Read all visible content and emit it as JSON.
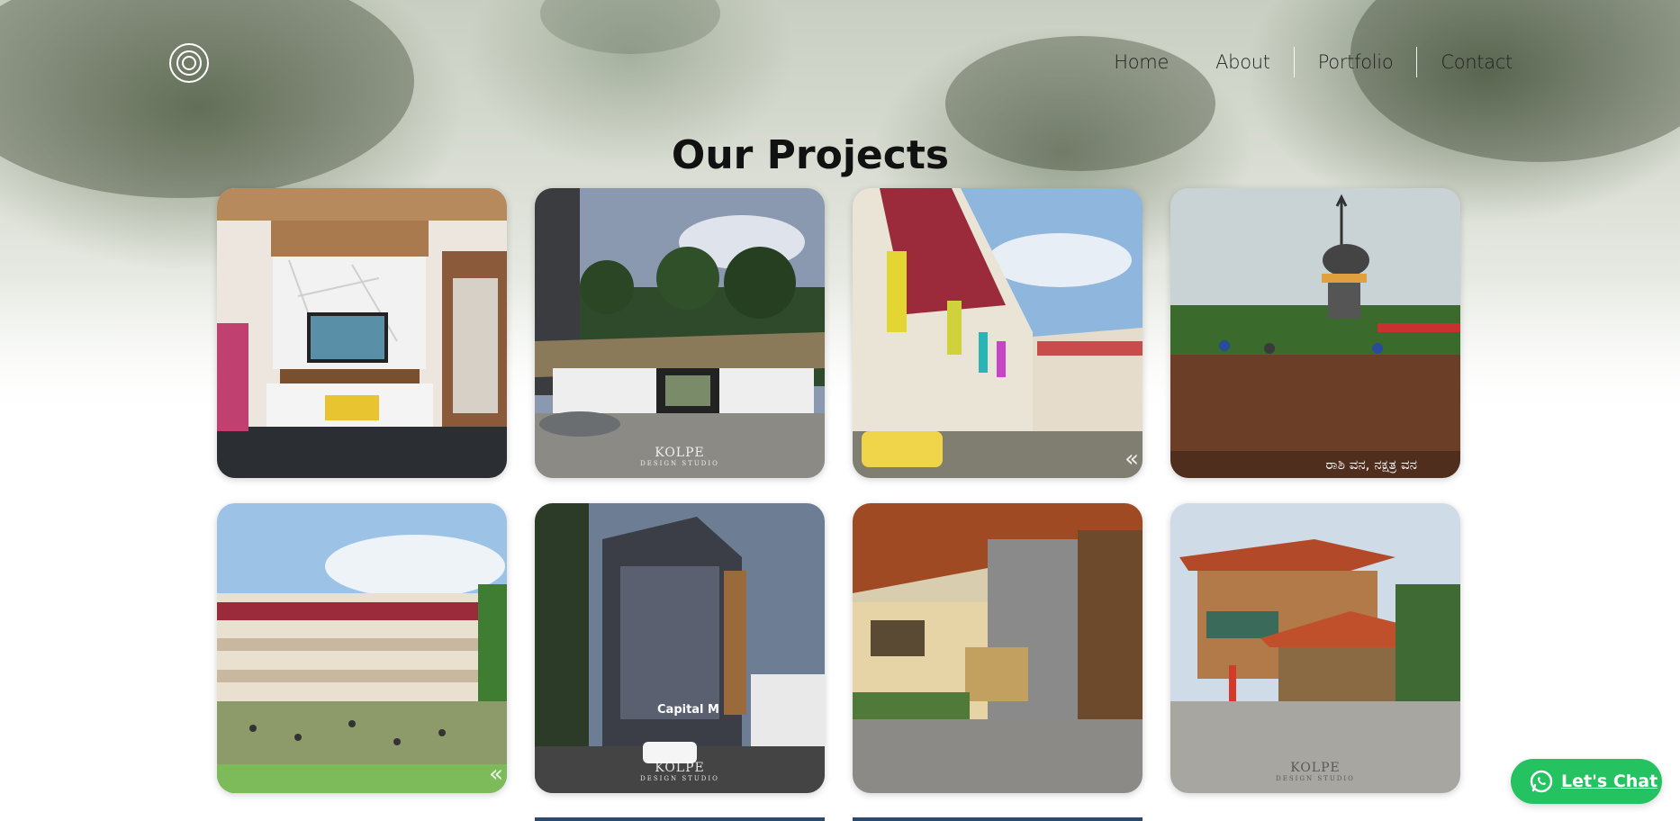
{
  "nav": {
    "logo": "logo",
    "items": [
      {
        "label": "Home"
      },
      {
        "label": "About"
      },
      {
        "label": "Portfolio"
      },
      {
        "label": "Contact"
      }
    ]
  },
  "page": {
    "title": "Our Projects"
  },
  "projects": [
    {
      "alt": "interior living room TV unit",
      "watermark": ""
    },
    {
      "alt": "resort entrance with palm trees",
      "watermark": "KOLPE"
    },
    {
      "alt": "school building courtyard",
      "watermark": ""
    },
    {
      "alt": "shiva statue forest site",
      "watermark": "",
      "caption": "ರಾಶಿ ವನ, ನಕ್ಷತ್ರ ವನ"
    },
    {
      "alt": "school campus with students",
      "watermark": ""
    },
    {
      "alt": "commercial building Capital M",
      "watermark": "KOLPE",
      "sign": "Capital M"
    },
    {
      "alt": "traditional veranda",
      "watermark": ""
    },
    {
      "alt": "traditional tiled roof house",
      "watermark": "KOLPE"
    }
  ],
  "watermark_sub": "DESIGN STUDIO",
  "chat": {
    "label": "Let's Chat",
    "color": "#25c262"
  }
}
